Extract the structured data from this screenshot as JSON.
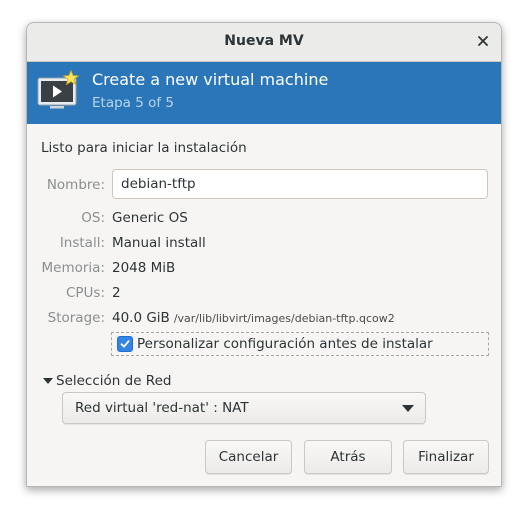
{
  "window": {
    "title": "Nueva MV",
    "close_icon": "close-icon"
  },
  "header": {
    "title": "Create a new virtual machine",
    "step": "Etapa 5 of 5",
    "icon": "virtual-machine-icon",
    "background": "#2a76b8"
  },
  "summary": {
    "heading": "Listo para iniciar la instalación",
    "name_label": "Nombre:",
    "name_value": "debian-tftp",
    "os_label": "OS:",
    "os_value": "Generic OS",
    "install_label": "Install:",
    "install_value": "Manual install",
    "memory_label": "Memoria:",
    "memory_value": "2048 MiB",
    "cpus_label": "CPUs:",
    "cpus_value": "2",
    "storage_label": "Storage:",
    "storage_size": "40.0 GiB",
    "storage_path": "/var/lib/libvirt/images/debian-tftp.qcow2"
  },
  "customize": {
    "label": "Personalizar configuración antes de instalar",
    "checked": true
  },
  "network": {
    "expander_label": "Selección de Red",
    "selected": "Red virtual 'red-nat' : NAT"
  },
  "buttons": {
    "cancel": "Cancelar",
    "back": "Atrás",
    "finish": "Finalizar"
  }
}
